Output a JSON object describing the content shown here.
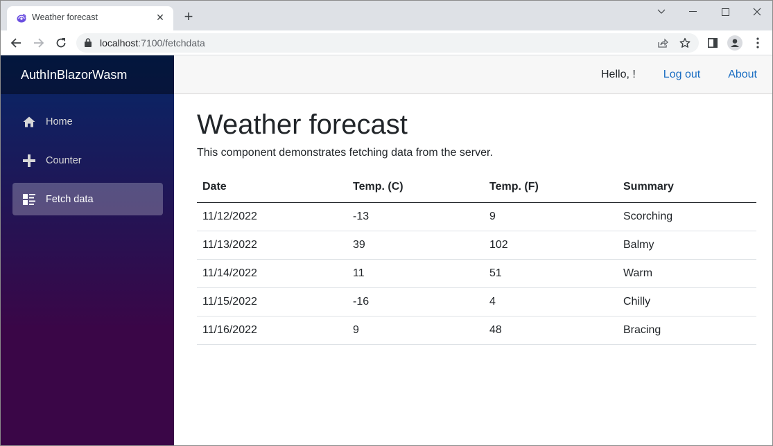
{
  "browser": {
    "tab_title": "Weather forecast",
    "url_host": "localhost",
    "url_path": ":7100/fetchdata",
    "new_tab_symbol": "+",
    "tab_close_symbol": "✕"
  },
  "app": {
    "brand": "AuthInBlazorWasm",
    "sidebar": {
      "items": [
        {
          "label": "Home",
          "icon": "home-icon",
          "active": false
        },
        {
          "label": "Counter",
          "icon": "plus-icon",
          "active": false
        },
        {
          "label": "Fetch data",
          "icon": "list-rich-icon",
          "active": true
        }
      ]
    },
    "top_row": {
      "greeting": "Hello, !",
      "logout_label": "Log out",
      "about_label": "About"
    },
    "page": {
      "title": "Weather forecast",
      "description": "This component demonstrates fetching data from the server.",
      "table": {
        "headers": [
          "Date",
          "Temp. (C)",
          "Temp. (F)",
          "Summary"
        ],
        "rows": [
          [
            "11/12/2022",
            "-13",
            "9",
            "Scorching"
          ],
          [
            "11/13/2022",
            "39",
            "102",
            "Balmy"
          ],
          [
            "11/14/2022",
            "11",
            "51",
            "Warm"
          ],
          [
            "11/15/2022",
            "-16",
            "4",
            "Chilly"
          ],
          [
            "11/16/2022",
            "9",
            "48",
            "Bracing"
          ]
        ]
      }
    }
  },
  "colors": {
    "link": "#1b6ec2",
    "sidebar_top": "#052767",
    "sidebar_bottom": "#3a0647",
    "favicon": "#6b4fe0"
  }
}
